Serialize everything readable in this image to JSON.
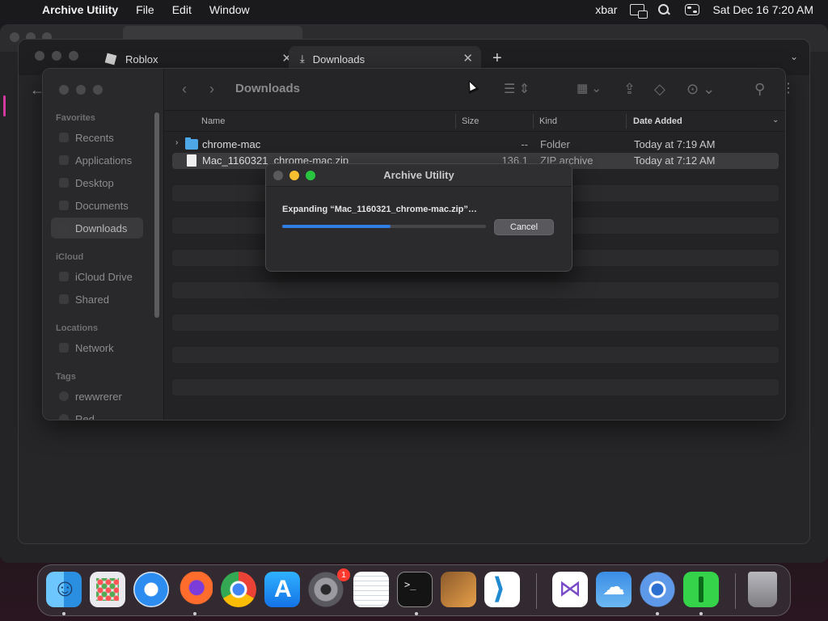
{
  "menubar": {
    "app_name": "Archive Utility",
    "menus": [
      "File",
      "Edit",
      "Window"
    ],
    "status_xbar": "xbar",
    "datetime": "Sat Dec 16  7:20 AM"
  },
  "browser": {
    "tabs": [
      {
        "label": "Roblox"
      },
      {
        "label": "Downloads"
      }
    ],
    "new_tab_symbol": "+"
  },
  "finder": {
    "title": "Downloads",
    "sidebar": {
      "favorites_header": "Favorites",
      "favorites": [
        "Recents",
        "Applications",
        "Desktop",
        "Documents",
        "Downloads"
      ],
      "icloud_header": "iCloud",
      "icloud": [
        "iCloud Drive",
        "Shared"
      ],
      "locations_header": "Locations",
      "locations": [
        "Network"
      ],
      "tags_header": "Tags",
      "tags": [
        "rewwrerer",
        "Red"
      ]
    },
    "columns": {
      "name": "Name",
      "size": "Size",
      "kind": "Kind",
      "date": "Date Added"
    },
    "files": [
      {
        "name": "chrome-mac",
        "size": "--",
        "kind": "Folder",
        "date": "Today at 7:19 AM"
      },
      {
        "name": "Mac_1160321_chrome-mac.zip",
        "size": "136.1 MB",
        "kind": "ZIP archive",
        "date": "Today at 7:12 AM"
      }
    ]
  },
  "archive_dialog": {
    "title": "Archive Utility",
    "message": "Expanding “Mac_1160321_chrome-mac.zip”…",
    "progress_percent": 53,
    "cancel_label": "Cancel"
  },
  "dock": {
    "settings_badge": "1"
  },
  "colors": {
    "accent_blue": "#2f7de1",
    "folder_blue": "#4ea8e8",
    "badge_red": "#ff3b30"
  }
}
